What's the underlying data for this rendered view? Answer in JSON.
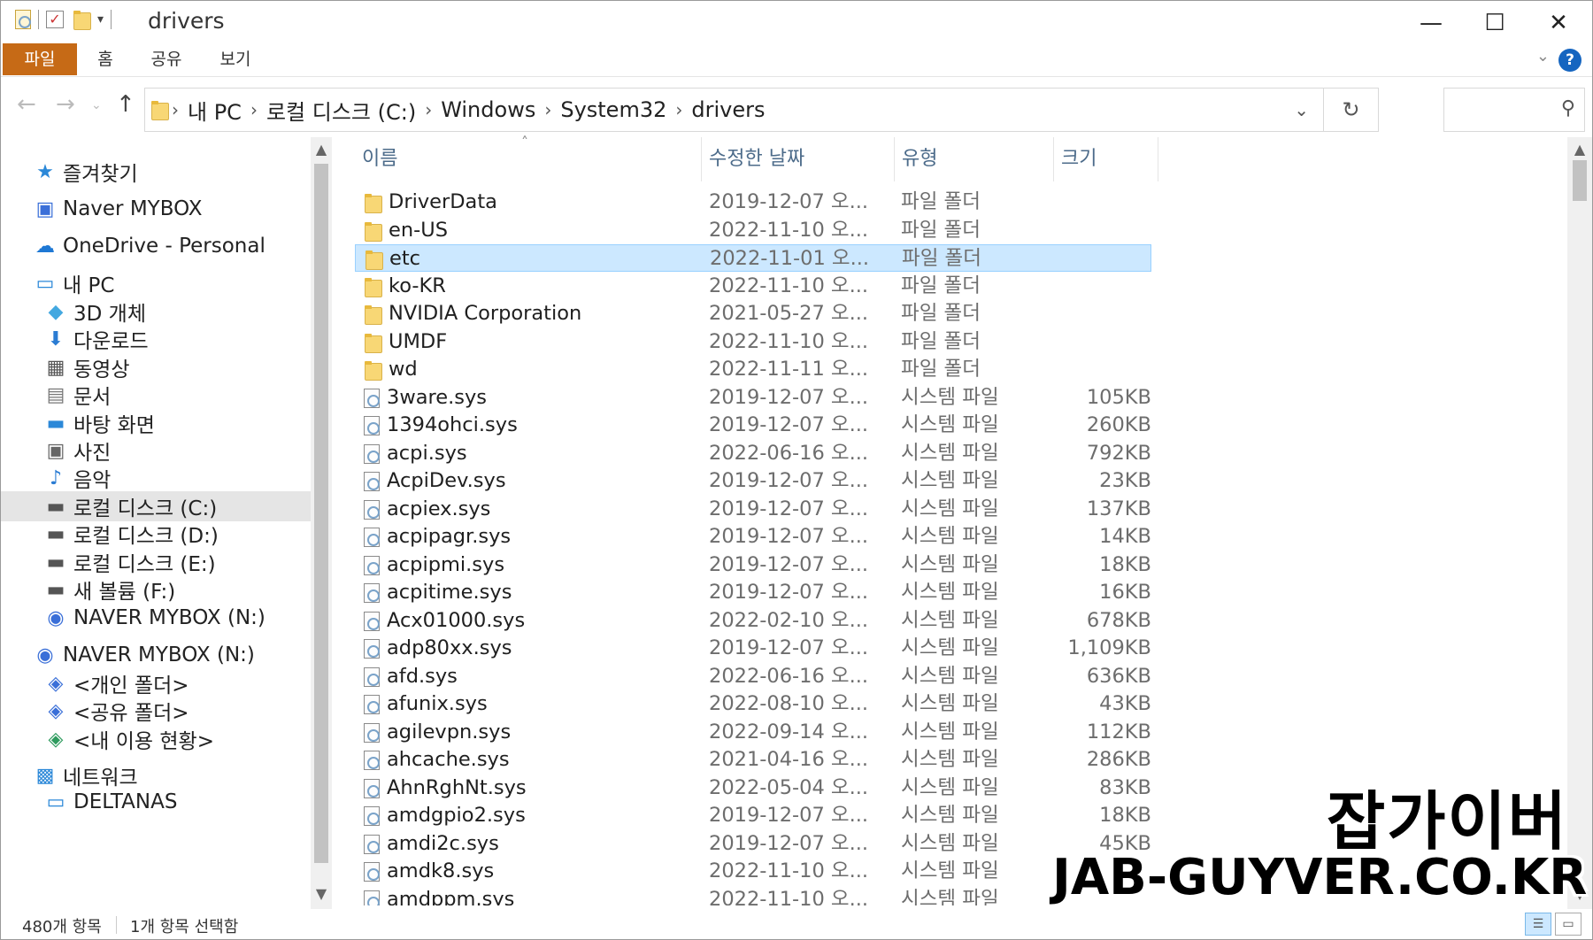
{
  "window": {
    "title": "drivers"
  },
  "ribbon": {
    "tabs": [
      "파일",
      "홈",
      "공유",
      "보기"
    ]
  },
  "address": {
    "breadcrumbs": [
      "내 PC",
      "로컬 디스크 (C:)",
      "Windows",
      "System32",
      "drivers"
    ],
    "search_placeholder": ""
  },
  "sidebar": {
    "items": [
      {
        "label": "즐겨찾기",
        "icon": "star-icon",
        "indent": 0
      },
      {
        "label": "Naver MYBOX",
        "icon": "naver-mybox-icon",
        "indent": 0
      },
      {
        "label": "OneDrive - Personal",
        "icon": "cloud-icon",
        "indent": 0
      },
      {
        "label": "내 PC",
        "icon": "computer-icon",
        "indent": 0
      },
      {
        "label": "3D 개체",
        "icon": "3d-objects-icon",
        "indent": 1
      },
      {
        "label": "다운로드",
        "icon": "download-icon",
        "indent": 1
      },
      {
        "label": "동영상",
        "icon": "video-icon",
        "indent": 1
      },
      {
        "label": "문서",
        "icon": "document-icon",
        "indent": 1
      },
      {
        "label": "바탕 화면",
        "icon": "desktop-icon",
        "indent": 1
      },
      {
        "label": "사진",
        "icon": "pictures-icon",
        "indent": 1
      },
      {
        "label": "음악",
        "icon": "music-icon",
        "indent": 1
      },
      {
        "label": "로컬 디스크 (C:)",
        "icon": "system-drive-icon",
        "indent": 1,
        "selected": true
      },
      {
        "label": "로컬 디스크 (D:)",
        "icon": "drive-icon",
        "indent": 1
      },
      {
        "label": "로컬 디스크 (E:)",
        "icon": "drive-icon",
        "indent": 1
      },
      {
        "label": "새 볼륨 (F:)",
        "icon": "drive-icon",
        "indent": 1
      },
      {
        "label": "NAVER MYBOX (N:)",
        "icon": "naver-drive-icon",
        "indent": 1
      },
      {
        "label": "NAVER MYBOX (N:)",
        "icon": "naver-drive-icon",
        "indent": 0
      },
      {
        "label": "<개인 폴더>",
        "icon": "naver-folder-icon",
        "indent": 1
      },
      {
        "label": "<공유 폴더>",
        "icon": "naver-folder-icon",
        "indent": 1
      },
      {
        "label": "<내 이용 현황>",
        "icon": "naver-usage-icon",
        "indent": 1
      },
      {
        "label": "네트워크",
        "icon": "network-icon",
        "indent": 0
      },
      {
        "label": "DELTANAS",
        "icon": "computer-icon",
        "indent": 1
      }
    ]
  },
  "columns": {
    "name": "이름",
    "date": "수정한 날짜",
    "type": "유형",
    "size": "크기"
  },
  "files": [
    {
      "name": "DriverData",
      "date": "2019-12-07 오...",
      "type": "파일 폴더",
      "size": "",
      "kind": "folder"
    },
    {
      "name": "en-US",
      "date": "2022-11-10 오...",
      "type": "파일 폴더",
      "size": "",
      "kind": "folder"
    },
    {
      "name": "etc",
      "date": "2022-11-01 오...",
      "type": "파일 폴더",
      "size": "",
      "kind": "folder",
      "selected": true
    },
    {
      "name": "ko-KR",
      "date": "2022-11-10 오...",
      "type": "파일 폴더",
      "size": "",
      "kind": "folder"
    },
    {
      "name": "NVIDIA Corporation",
      "date": "2021-05-27 오...",
      "type": "파일 폴더",
      "size": "",
      "kind": "folder"
    },
    {
      "name": "UMDF",
      "date": "2022-11-10 오...",
      "type": "파일 폴더",
      "size": "",
      "kind": "folder"
    },
    {
      "name": "wd",
      "date": "2022-11-11 오...",
      "type": "파일 폴더",
      "size": "",
      "kind": "folder"
    },
    {
      "name": "3ware.sys",
      "date": "2019-12-07 오...",
      "type": "시스템 파일",
      "size": "105KB",
      "kind": "file"
    },
    {
      "name": "1394ohci.sys",
      "date": "2019-12-07 오...",
      "type": "시스템 파일",
      "size": "260KB",
      "kind": "file"
    },
    {
      "name": "acpi.sys",
      "date": "2022-06-16 오...",
      "type": "시스템 파일",
      "size": "792KB",
      "kind": "file"
    },
    {
      "name": "AcpiDev.sys",
      "date": "2019-12-07 오...",
      "type": "시스템 파일",
      "size": "23KB",
      "kind": "file"
    },
    {
      "name": "acpiex.sys",
      "date": "2019-12-07 오...",
      "type": "시스템 파일",
      "size": "137KB",
      "kind": "file"
    },
    {
      "name": "acpipagr.sys",
      "date": "2019-12-07 오...",
      "type": "시스템 파일",
      "size": "14KB",
      "kind": "file"
    },
    {
      "name": "acpipmi.sys",
      "date": "2019-12-07 오...",
      "type": "시스템 파일",
      "size": "18KB",
      "kind": "file"
    },
    {
      "name": "acpitime.sys",
      "date": "2019-12-07 오...",
      "type": "시스템 파일",
      "size": "16KB",
      "kind": "file"
    },
    {
      "name": "Acx01000.sys",
      "date": "2022-02-10 오...",
      "type": "시스템 파일",
      "size": "678KB",
      "kind": "file"
    },
    {
      "name": "adp80xx.sys",
      "date": "2019-12-07 오...",
      "type": "시스템 파일",
      "size": "1,109KB",
      "kind": "file"
    },
    {
      "name": "afd.sys",
      "date": "2022-06-16 오...",
      "type": "시스템 파일",
      "size": "636KB",
      "kind": "file"
    },
    {
      "name": "afunix.sys",
      "date": "2022-08-10 오...",
      "type": "시스템 파일",
      "size": "43KB",
      "kind": "file"
    },
    {
      "name": "agilevpn.sys",
      "date": "2022-09-14 오...",
      "type": "시스템 파일",
      "size": "112KB",
      "kind": "file"
    },
    {
      "name": "ahcache.sys",
      "date": "2021-04-16 오...",
      "type": "시스템 파일",
      "size": "286KB",
      "kind": "file"
    },
    {
      "name": "AhnRghNt.sys",
      "date": "2022-05-04 오...",
      "type": "시스템 파일",
      "size": "83KB",
      "kind": "file"
    },
    {
      "name": "amdgpio2.sys",
      "date": "2019-12-07 오...",
      "type": "시스템 파일",
      "size": "18KB",
      "kind": "file"
    },
    {
      "name": "amdi2c.sys",
      "date": "2019-12-07 오...",
      "type": "시스템 파일",
      "size": "45KB",
      "kind": "file"
    },
    {
      "name": "amdk8.sys",
      "date": "2022-11-10 오...",
      "type": "시스템 파일",
      "size": "",
      "kind": "file"
    },
    {
      "name": "amdppm.sys",
      "date": "2022-11-10 오...",
      "type": "시스템 파일",
      "size": "",
      "kind": "file"
    }
  ],
  "status": {
    "item_count": "480개 항목",
    "selection": "1개 항목 선택함"
  },
  "watermark": {
    "line1": "잡가이버",
    "line2": "JAB-GUYVER.CO.KR"
  },
  "colors": {
    "file_tab": "#c66a16",
    "selection": "#cce8ff",
    "header_text": "#4c6b8a"
  }
}
